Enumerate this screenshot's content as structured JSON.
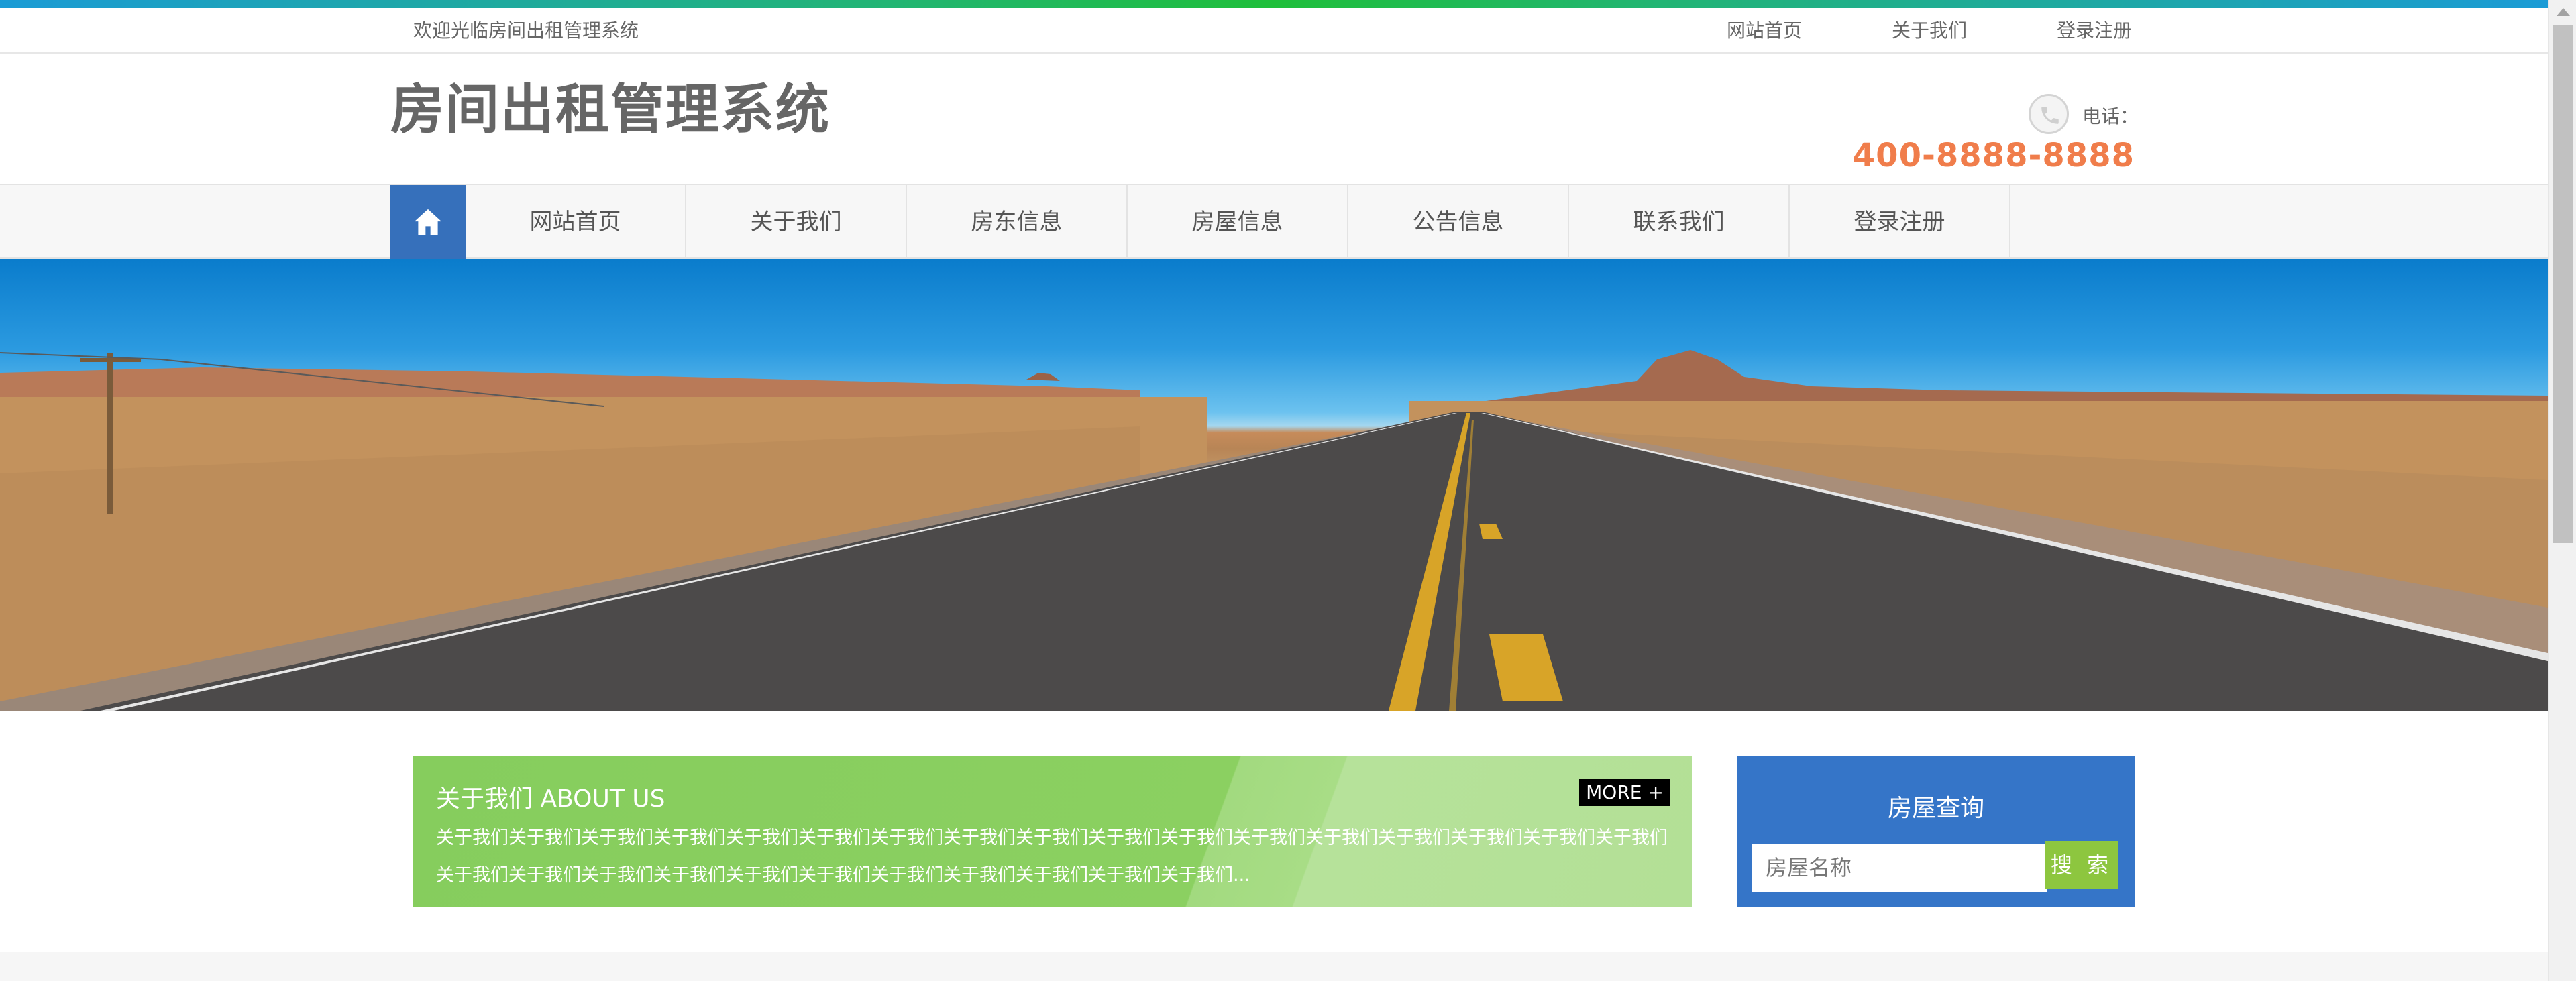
{
  "topbar": {
    "welcome": "欢迎光临房间出租管理系统",
    "links": [
      "网站首页",
      "关于我们",
      "登录注册"
    ]
  },
  "header": {
    "logo": "房间出租管理系统",
    "phone_label": "电话：",
    "phone_number": "400-8888-8888"
  },
  "nav": {
    "home_icon": "home-icon",
    "items": [
      "网站首页",
      "关于我们",
      "房东信息",
      "房屋信息",
      "公告信息",
      "联系我们",
      "登录注册"
    ]
  },
  "banner": {
    "slides": 3,
    "active_slide": 2
  },
  "about": {
    "title": "关于我们 ABOUT US",
    "more": "MORE +",
    "text": "关于我们关于我们关于我们关于我们关于我们关于我们关于我们关于我们关于我们关于我们关于我们关于我们关于我们关于我们关于我们关于我们关于我们关于我们关于我们关于我们关于我们关于我们关于我们关于我们关于我们关于我们关于我们关于我们..."
  },
  "search": {
    "title": "房屋查询",
    "placeholder": "房屋名称",
    "button": "搜 索"
  },
  "colors": {
    "accent_blue": "#3670bb",
    "accent_green": "#8dc63f",
    "phone_orange": "#f07d4b"
  }
}
